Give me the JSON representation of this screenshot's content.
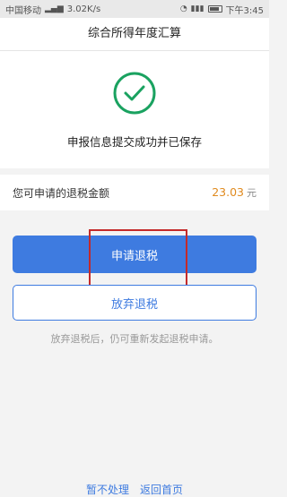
{
  "statusbar": {
    "carrier": "中国移动",
    "speed": "3.02K/s",
    "time": "下午3:45"
  },
  "header": {
    "title": "综合所得年度汇算"
  },
  "result": {
    "icon": "check-circle-icon",
    "message": "申报信息提交成功并已保存"
  },
  "refund": {
    "label": "您可申请的退税金额",
    "amount": "23.03",
    "unit": "元"
  },
  "actions": {
    "apply_label": "申请退税",
    "abandon_label": "放弃退税",
    "hint": "放弃退税后，仍可重新发起退税申请。"
  },
  "footer": {
    "later_label": "暂不处理",
    "home_label": "返回首页"
  },
  "colors": {
    "primary": "#3e7be0",
    "success": "#1aa260",
    "amount": "#e08a1e",
    "highlight": "#c42a2a"
  }
}
